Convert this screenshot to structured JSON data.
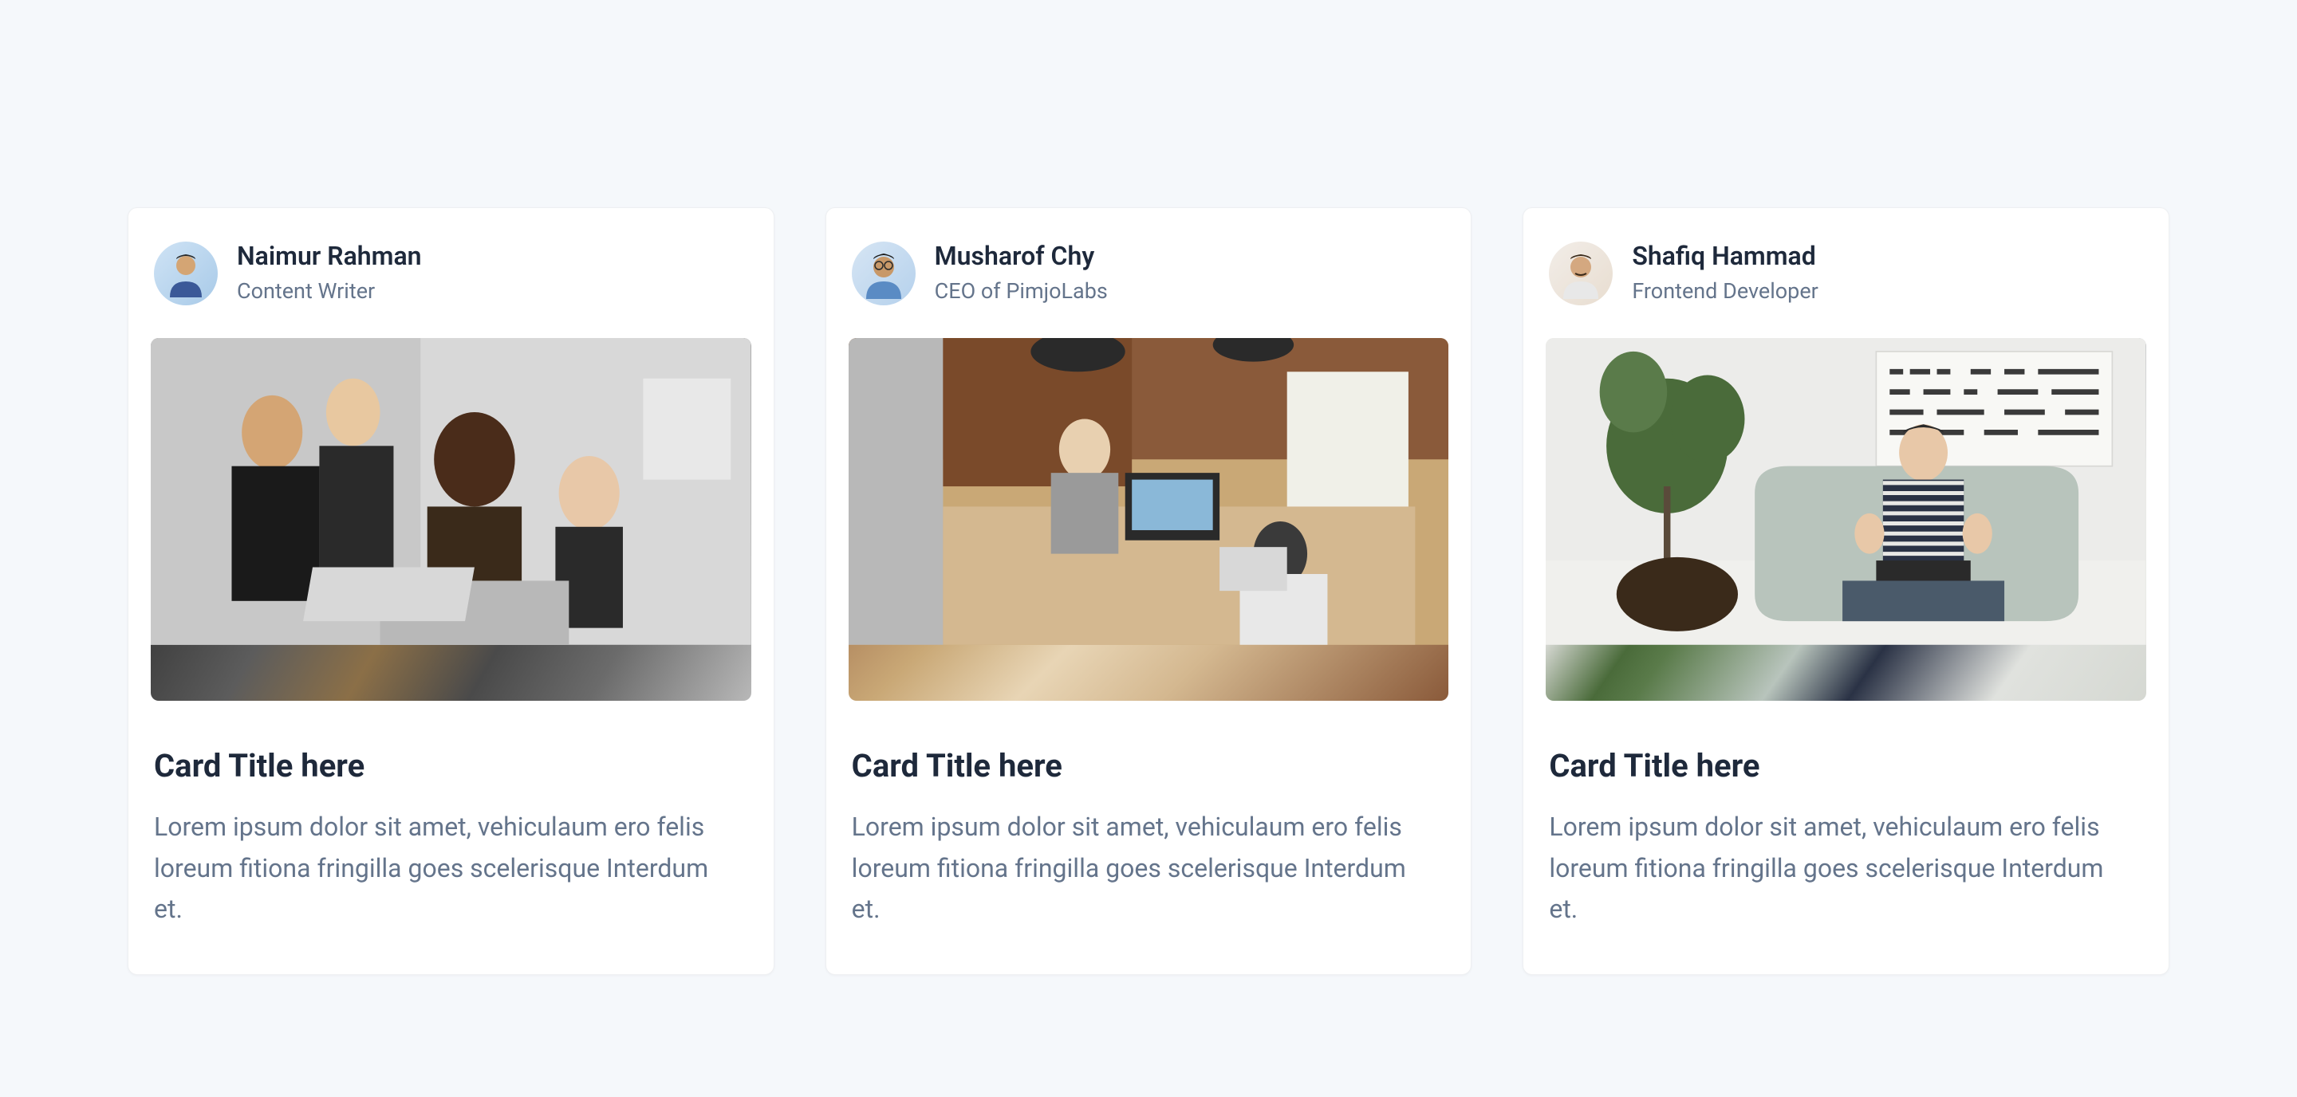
{
  "cards": [
    {
      "author": {
        "name": "Naimur Rahman",
        "role": "Content Writer"
      },
      "title": "Card Title here",
      "description": "Lorem ipsum dolor sit amet, vehiculaum ero felis loreum fitiona fringilla goes scelerisque Interdum et."
    },
    {
      "author": {
        "name": "Musharof Chy",
        "role": "CEO of PimjoLabs"
      },
      "title": "Card Title here",
      "description": "Lorem ipsum dolor sit amet, vehiculaum ero felis loreum fitiona fringilla goes scelerisque Interdum et."
    },
    {
      "author": {
        "name": "Shafiq Hammad",
        "role": "Frontend Developer"
      },
      "title": "Card Title here",
      "description": "Lorem ipsum dolor sit amet, vehiculaum ero felis loreum fitiona fringilla goes scelerisque Interdum et."
    }
  ]
}
